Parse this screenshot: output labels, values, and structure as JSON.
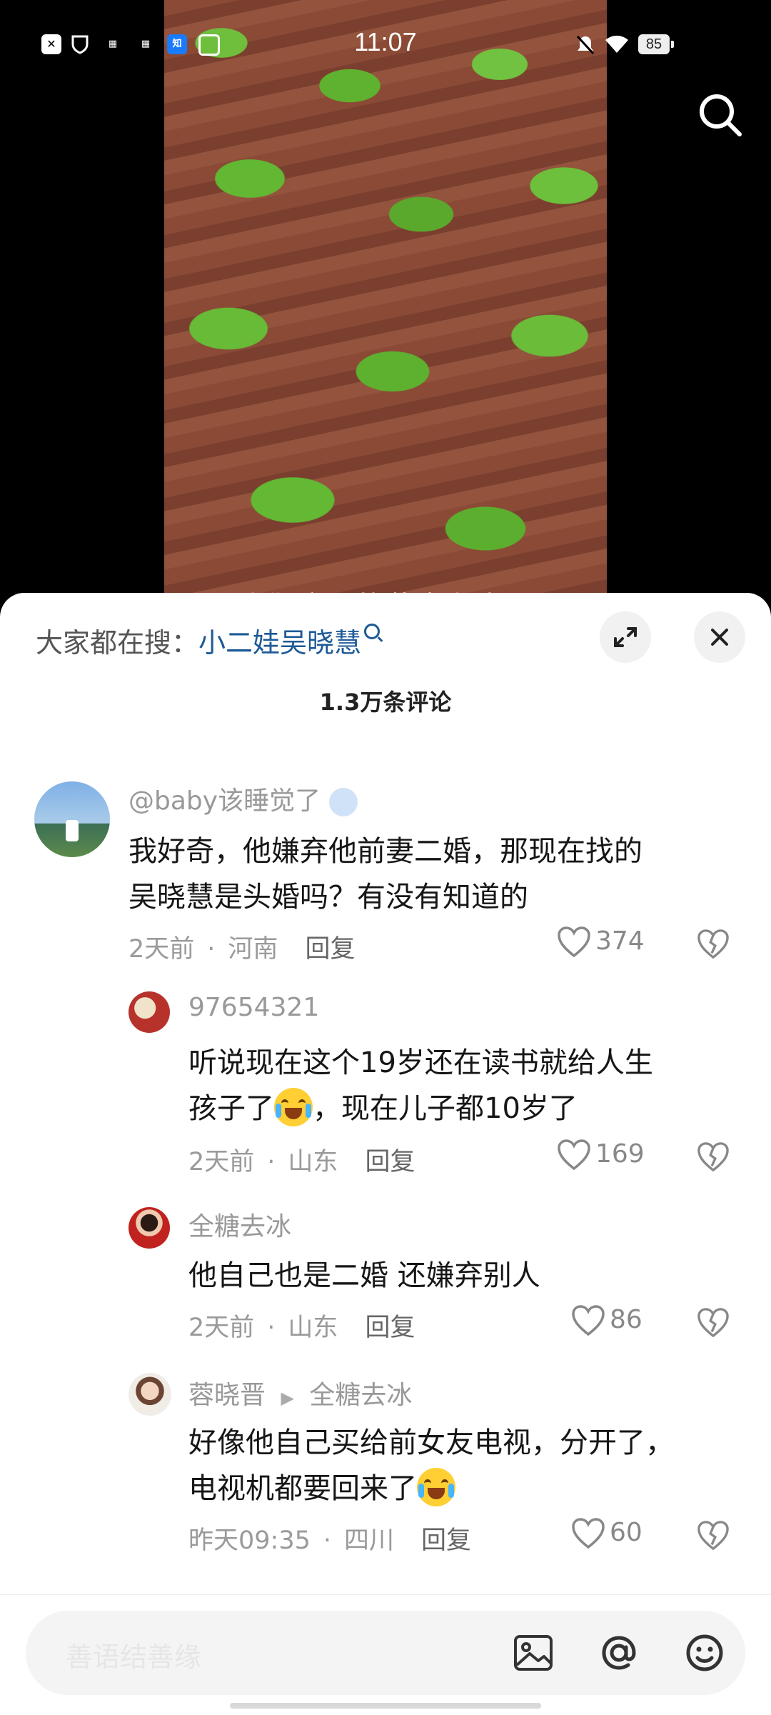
{
  "status_bar": {
    "time": "11:07",
    "battery": "85",
    "app_icons": [
      "x-app-icon",
      "shield-icon",
      "toutiao-icon",
      "toutiao-icon",
      "zhihu-icon",
      "image-icon"
    ]
  },
  "video": {
    "subtitle_partial": "我们这里的花生在土"
  },
  "header": {
    "search_prefix": "大家都在搜：",
    "search_term": "小二娃吴晓慧",
    "comment_count": "1.3万条评论"
  },
  "comments": [
    {
      "username": "@baby该睡觉了",
      "text_line1": "我好奇，他嫌弃他前妻二婚，那现在找的",
      "text_line2": "吴晓慧是头婚吗？有没有知道的",
      "time": "2天前",
      "location": "河南",
      "reply_label": "回复",
      "likes": "374"
    },
    {
      "username": "97654321",
      "text_line1": "听说现在这个19岁还在读书就给人生",
      "text_line2a": "孩子了",
      "text_line2b": "，现在儿子都10岁了",
      "time": "2天前",
      "location": "山东",
      "reply_label": "回复",
      "likes": "169"
    },
    {
      "username": "全糖去冰",
      "text_line1": "他自己也是二婚 还嫌弃别人",
      "time": "2天前",
      "location": "山东",
      "reply_label": "回复",
      "likes": "86"
    },
    {
      "username": "蓉晓晋",
      "reply_to": "全糖去冰",
      "text_line1": "好像他自己买给前女友电视，分开了，",
      "text_line2": "电视机都要回来了",
      "time": "昨天09:35",
      "location": "四川",
      "reply_label": "回复",
      "likes": "60"
    }
  ],
  "input": {
    "placeholder": "善语结善缘"
  },
  "colors": {
    "accent_link": "#1d5a96",
    "sheet_bg": "#ffffff",
    "muted_text": "#999999"
  }
}
